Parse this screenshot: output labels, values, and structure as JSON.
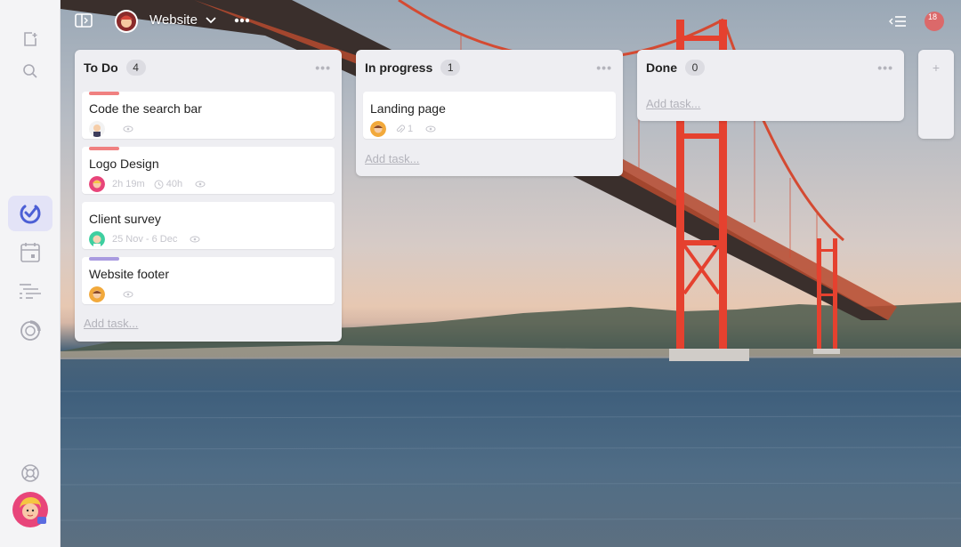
{
  "topbar": {
    "board_name": "Website",
    "notification_count": "18"
  },
  "columns": [
    {
      "title": "To Do",
      "count": "4",
      "add_label": "Add task...",
      "cards": [
        {
          "title": "Code the search bar",
          "bar_color": "#f08080"
        },
        {
          "title": "Logo Design",
          "bar_color": "#f08080",
          "time_spent": "2h 19m",
          "estimate": "40h"
        },
        {
          "title": "Client survey",
          "date_range": "25 Nov - 6 Dec"
        },
        {
          "title": "Website footer",
          "bar_color": "#a99be0"
        }
      ]
    },
    {
      "title": "In progress",
      "count": "1",
      "add_label": "Add task...",
      "cards": [
        {
          "title": "Landing page",
          "attachments": "1"
        }
      ]
    },
    {
      "title": "Done",
      "count": "0",
      "add_label": "Add task..."
    }
  ],
  "colors": {
    "accent": "#4c5fd5",
    "label_red": "#f08080",
    "label_purple": "#a99be0",
    "badge": "#ef5350"
  },
  "icons": [
    "new-task-icon",
    "search-icon",
    "tasks-check-icon",
    "calendar-icon",
    "timeline-icon",
    "reports-icon",
    "help-icon",
    "sidebar-toggle-icon",
    "more-icon",
    "activity-icon",
    "notification-icon",
    "eye-icon",
    "clock-icon",
    "paperclip-icon",
    "add-column-icon"
  ]
}
